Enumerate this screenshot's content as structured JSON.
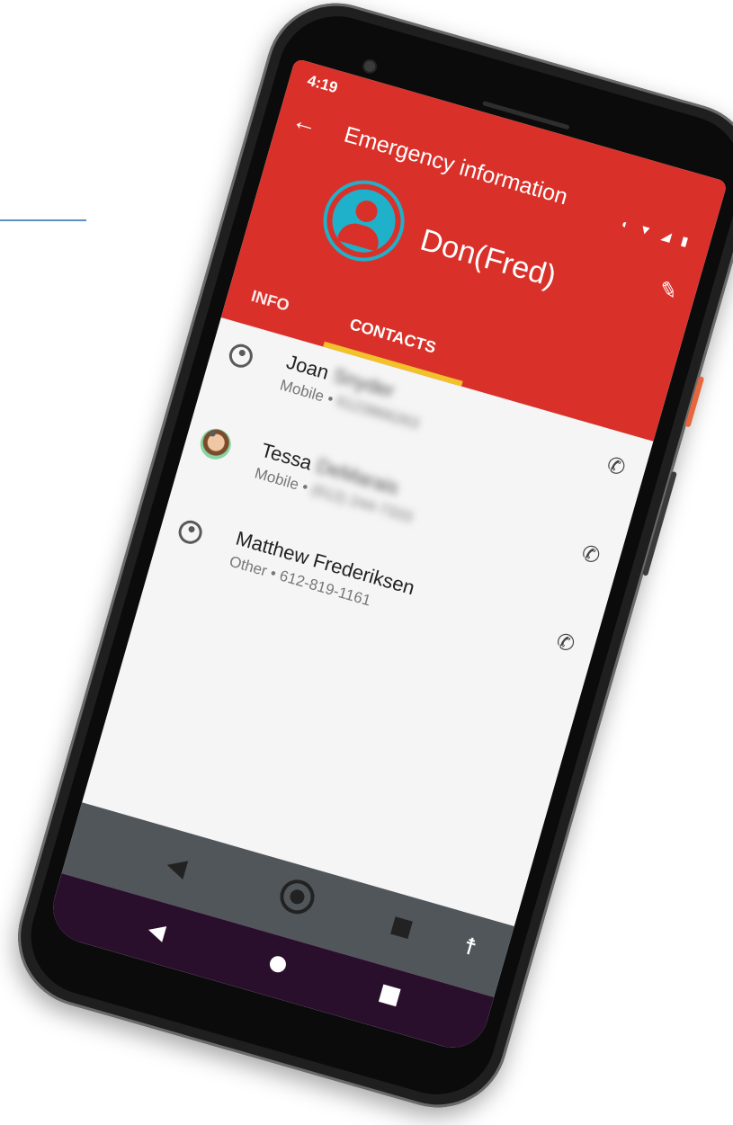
{
  "status_bar": {
    "time": "4:19",
    "icons": "◐ ▼ ◢ ▮"
  },
  "app_bar": {
    "title": "Emergency information",
    "profile_name": "Don(Fred)",
    "tabs": [
      {
        "label": "INFO",
        "selected": false
      },
      {
        "label": "CONTACTS",
        "selected": true
      }
    ]
  },
  "contacts": [
    {
      "first": "Joan",
      "last": "Snyder",
      "type": "Mobile",
      "phone": "6123866263"
    },
    {
      "first": "Tessa",
      "last": "DeMarais",
      "type": "Mobile",
      "phone": "(612) 244-7333"
    },
    {
      "first": "Matthew",
      "last": "Frederiksen",
      "type": "Other",
      "phone": "612-819-1161"
    }
  ],
  "icons": {
    "back": "arrow-left",
    "edit": "pencil",
    "call": "phone",
    "nav_back": "triangle-left",
    "nav_home": "circle",
    "nav_recent": "square",
    "accessibility": "person"
  },
  "colors": {
    "accent": "#d9312a",
    "avatar": "#1fb1c9",
    "tab_indicator": "#f2c22a"
  }
}
